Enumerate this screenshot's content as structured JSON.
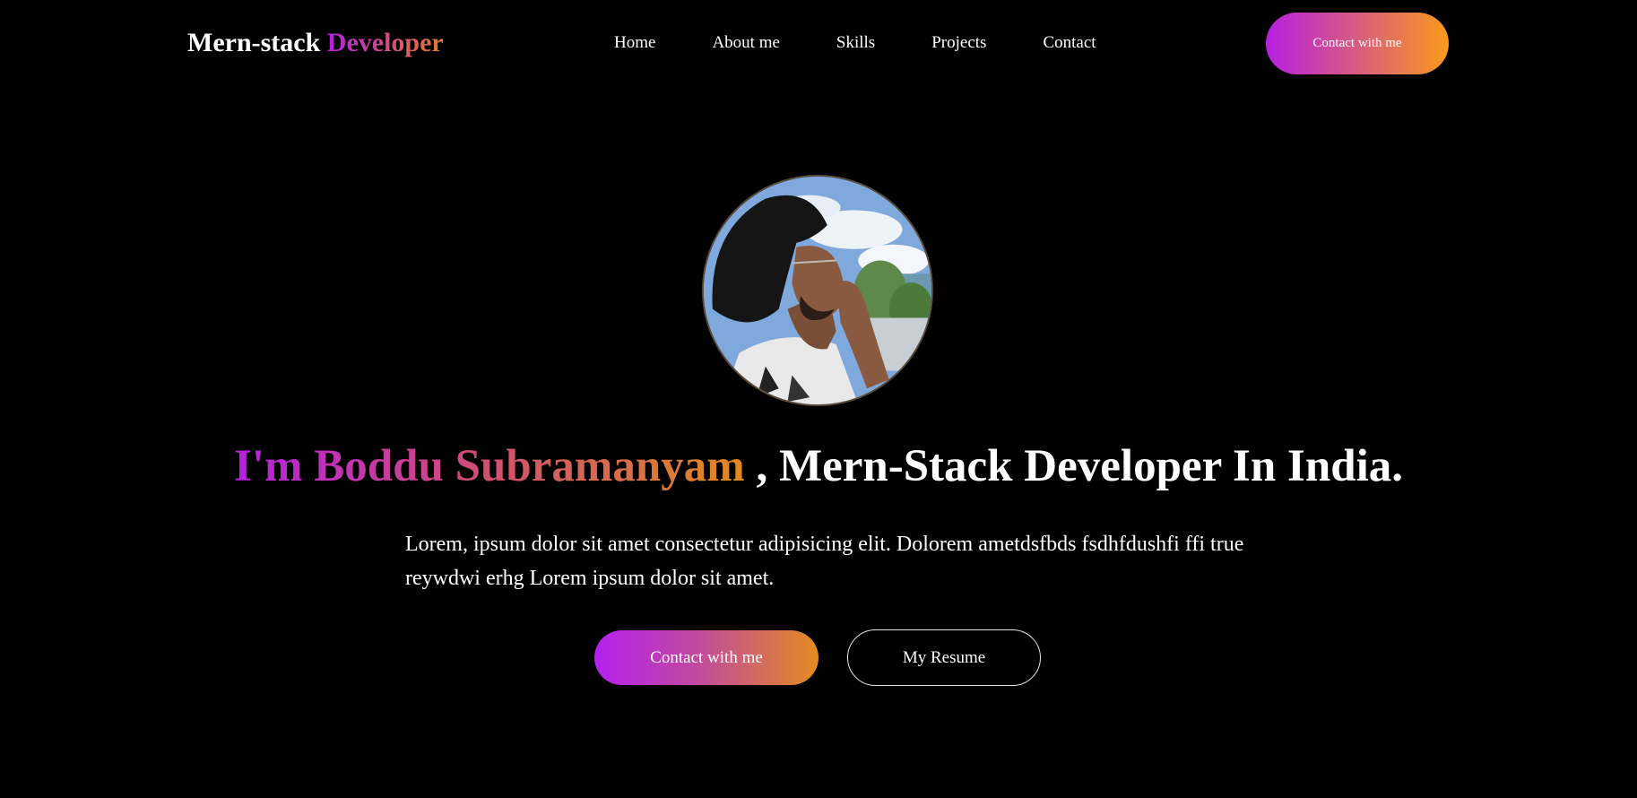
{
  "nav": {
    "logo_main": "Mern-stack",
    "logo_accent": "Developer",
    "links": [
      {
        "label": "Home"
      },
      {
        "label": "About me"
      },
      {
        "label": "Skills"
      },
      {
        "label": "Projects"
      },
      {
        "label": "Contact"
      }
    ],
    "cta_label": "Contact with me"
  },
  "hero": {
    "headline_name": "I'm Boddu Subramanyam",
    "headline_rest": " , Mern-Stack Developer In India.",
    "description": "Lorem, ipsum dolor sit amet consectetur adipisicing elit. Dolorem ametdsfbds fsdhfdushfi ffi true reywdwi erhg Lorem ipsum dolor sit amet.",
    "primary_button": "Contact with me",
    "secondary_button": "My Resume"
  },
  "colors": {
    "background": "#000000",
    "text": "#ffffff",
    "gradient_start": "#b620e0",
    "gradient_end": "#f99a1c"
  },
  "icons": {
    "avatar": "profile-photo"
  }
}
